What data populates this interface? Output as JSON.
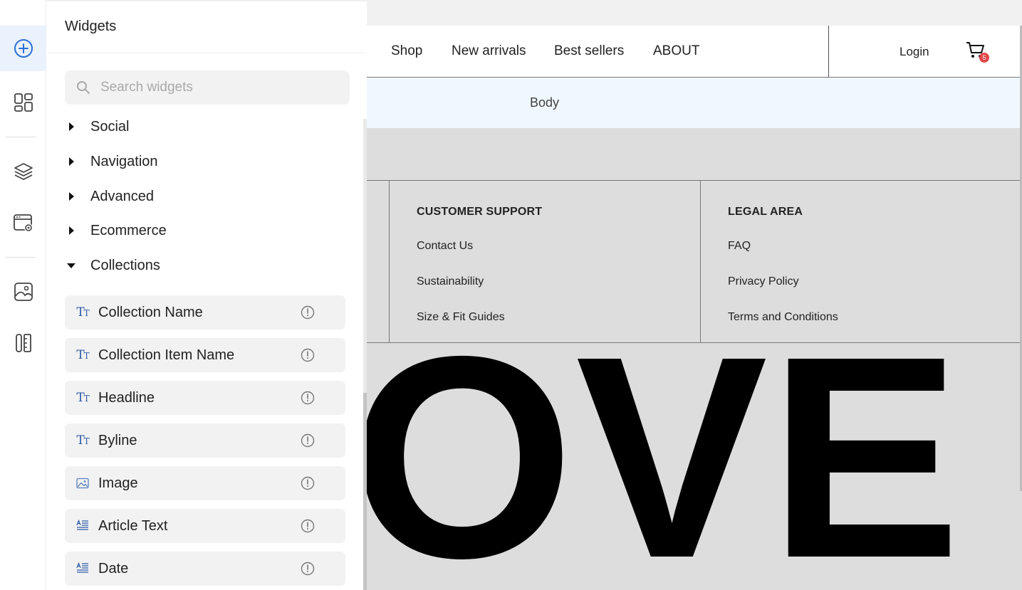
{
  "panel": {
    "title": "Widgets",
    "search_placeholder": "Search widgets",
    "categories": [
      {
        "label": "Social",
        "expanded": false
      },
      {
        "label": "Navigation",
        "expanded": false
      },
      {
        "label": "Advanced",
        "expanded": false
      },
      {
        "label": "Ecommerce",
        "expanded": false
      },
      {
        "label": "Collections",
        "expanded": true
      }
    ],
    "collection_widgets": [
      {
        "label": "Collection Name",
        "icon": "text-type-icon"
      },
      {
        "label": "Collection Item Name",
        "icon": "text-type-icon"
      },
      {
        "label": "Headline",
        "icon": "text-type-icon"
      },
      {
        "label": "Byline",
        "icon": "text-type-icon"
      },
      {
        "label": "Image",
        "icon": "image-icon"
      },
      {
        "label": "Article Text",
        "icon": "paragraph-icon"
      },
      {
        "label": "Date",
        "icon": "paragraph-icon"
      }
    ]
  },
  "rail": {
    "items": [
      "add-icon",
      "widgets-grid-icon",
      "layers-icon",
      "site-settings-icon",
      "media-icon",
      "design-icon"
    ],
    "active": "add-icon"
  },
  "site": {
    "nav": [
      "Shop",
      "New arrivals",
      "Best sellers",
      "ABOUT"
    ],
    "login": "Login",
    "cart_count": "5",
    "section_label": "Body",
    "footer": {
      "customer_support": {
        "heading": "CUSTOMER SUPPORT",
        "links": [
          "Contact Us",
          "Sustainability",
          "Size & Fit Guides"
        ]
      },
      "legal_area": {
        "heading": "LEGAL AREA",
        "links": [
          "FAQ",
          "Privacy Policy",
          "Terms and Conditions"
        ]
      }
    },
    "big_text": "OVE"
  },
  "colors": {
    "accent": "#2c5aa8",
    "active_bg": "#eaf2fd",
    "badge": "#e04848",
    "canvas_bg": "#dddddd"
  }
}
